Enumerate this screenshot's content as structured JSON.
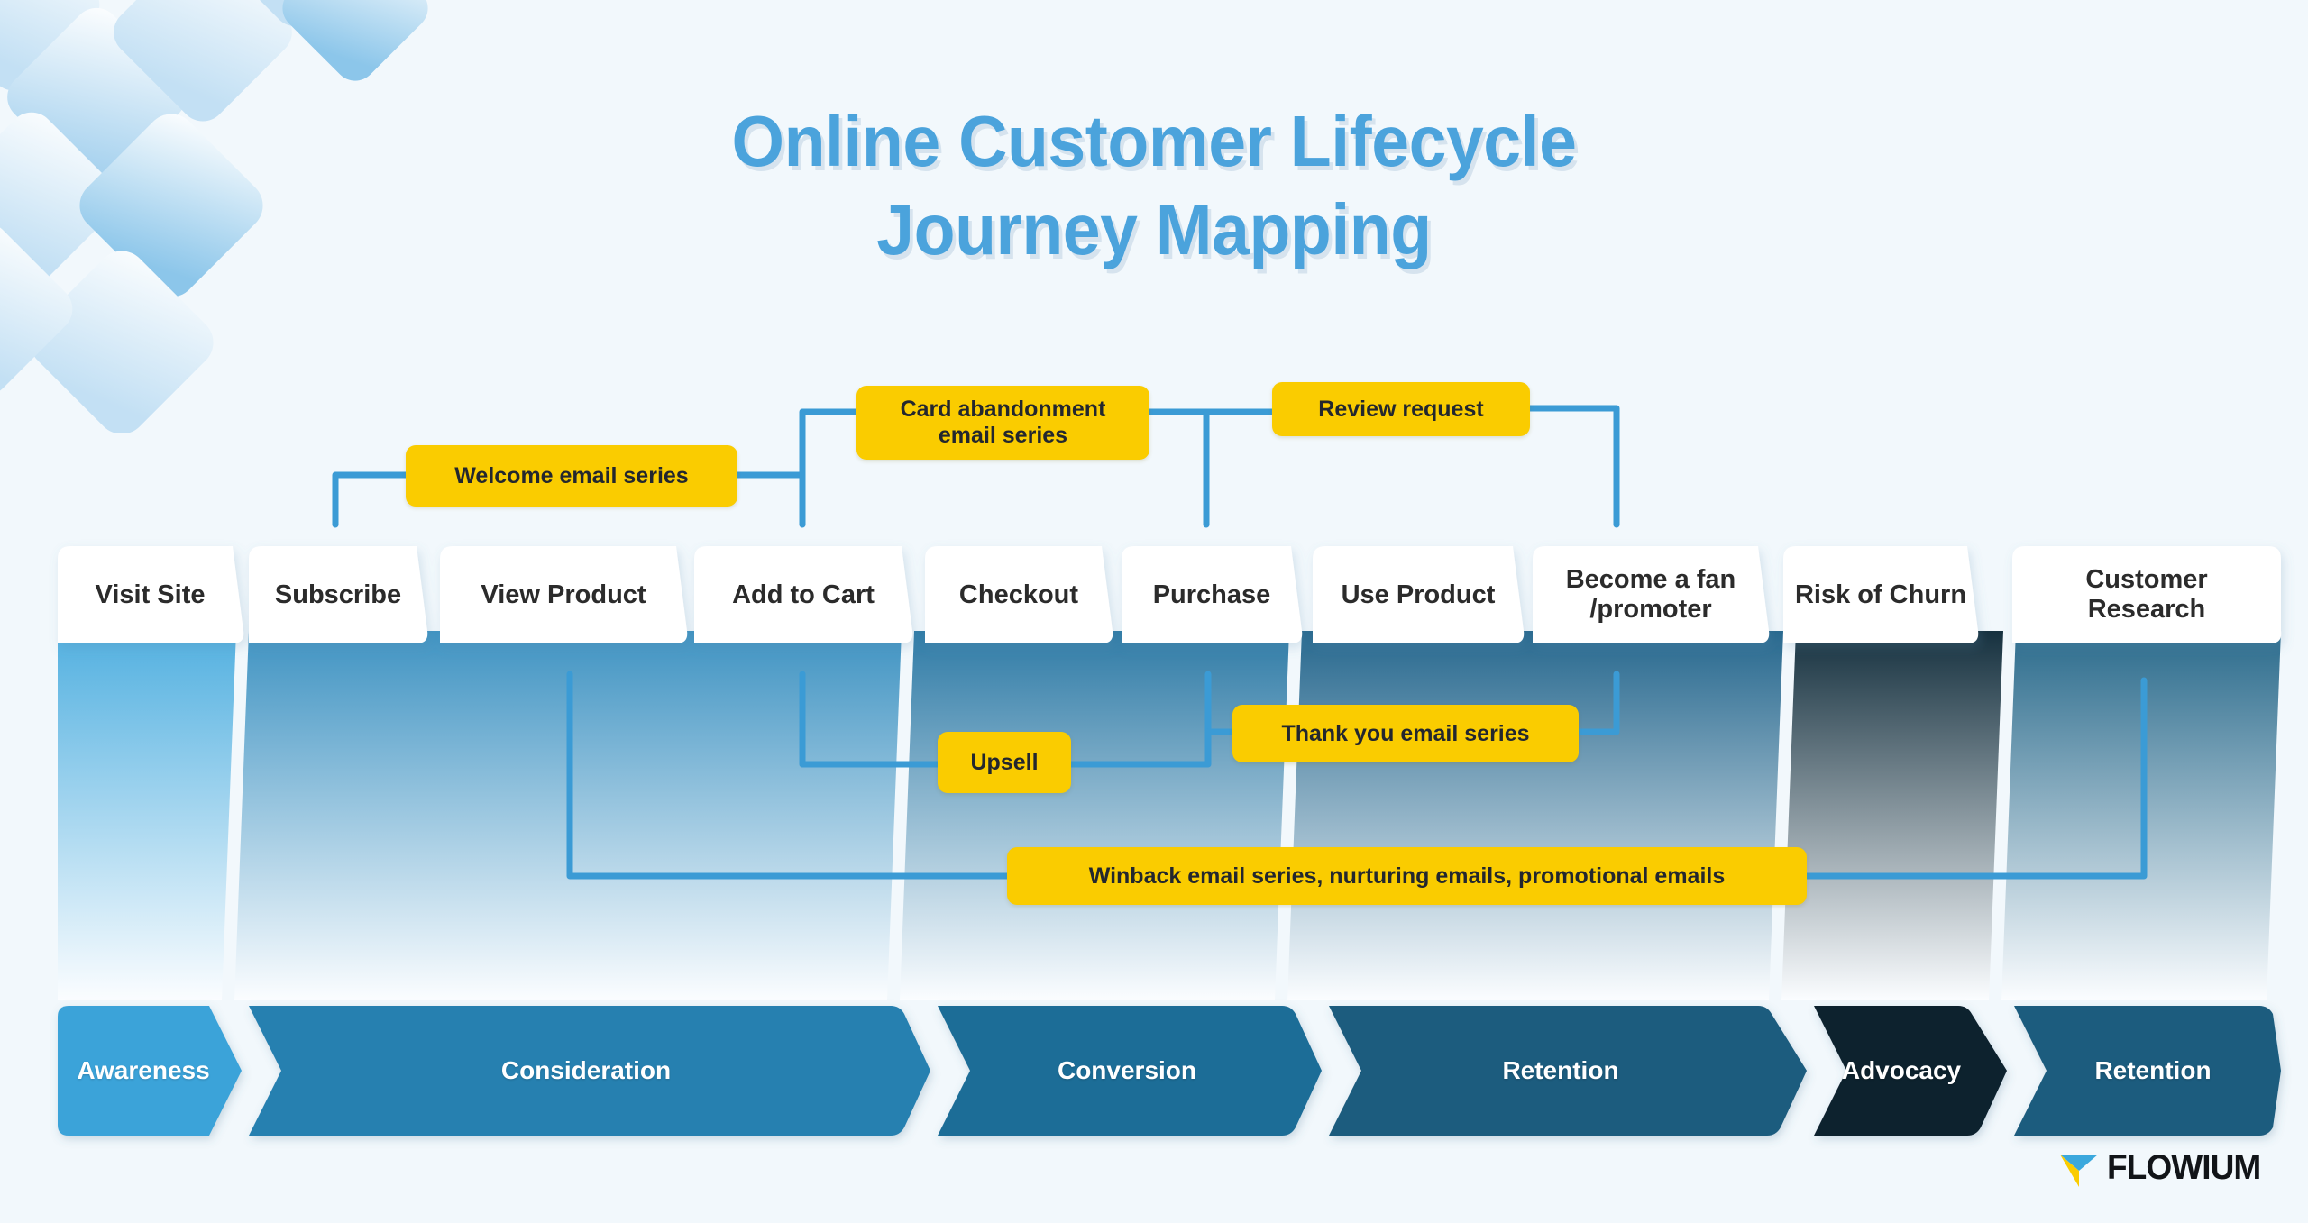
{
  "title": {
    "line1": "Online Customer Lifecycle",
    "line2": "Journey Mapping"
  },
  "colors": {
    "background": "#f2f8fc",
    "title": "#4ba3dc",
    "connector": "#3b9bd5",
    "accent_yellow": "#facc00",
    "yellow_text": "#23272e",
    "stage_card_bg": "#ffffff",
    "stage_card_text": "#2b2b2b",
    "phase_awareness": "#3ba3d9",
    "phase_consideration": "#2580b0",
    "phase_conversion": "#1f6d97",
    "phase_retention": "#1a5c7e",
    "phase_advocacy": "#10212e"
  },
  "stages": [
    {
      "label": "Visit Site"
    },
    {
      "label": "Subscribe"
    },
    {
      "label": "View Product"
    },
    {
      "label": "Add to Cart"
    },
    {
      "label": "Checkout"
    },
    {
      "label": "Purchase"
    },
    {
      "label": "Use Product"
    },
    {
      "label": "Become a fan\n/promoter"
    },
    {
      "label": "Risk of Churn"
    },
    {
      "label": "Customer\nResearch"
    }
  ],
  "phases": [
    {
      "label": "Awareness",
      "color": "#3ba3d9"
    },
    {
      "label": "Consideration",
      "color": "#2580b0"
    },
    {
      "label": "Conversion",
      "color": "#1f6d97"
    },
    {
      "label": "Retention",
      "color": "#1a5c7e"
    },
    {
      "label": "Advocacy",
      "color": "#10212e"
    },
    {
      "label": "Retention",
      "color": "#1a5c7e"
    }
  ],
  "email_boxes": [
    {
      "id": "welcome",
      "label": "Welcome email series"
    },
    {
      "id": "cart",
      "label": "Card abandonment\nemail series"
    },
    {
      "id": "review",
      "label": "Review request"
    },
    {
      "id": "upsell",
      "label": "Upsell"
    },
    {
      "id": "thankyou",
      "label": "Thank you email series"
    },
    {
      "id": "winback",
      "label": "Winback email series, nurturing emails, promotional emails"
    }
  ],
  "logo": {
    "word": "FLOWIUM",
    "mark_blue": "#3ba8dd",
    "mark_yellow": "#facc00"
  }
}
